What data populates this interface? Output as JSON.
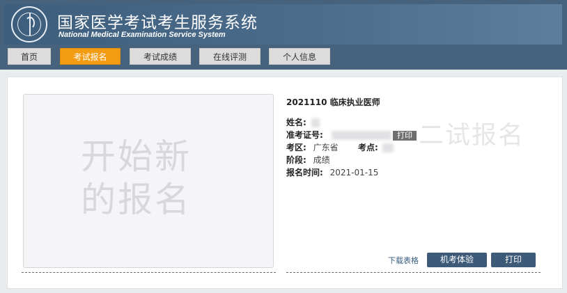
{
  "header": {
    "title_cn": "国家医学考试考生服务系统",
    "title_en": "National Medical Examination Service System",
    "emblem_icon": "medical-caduceus-icon"
  },
  "nav": {
    "items": [
      {
        "label": "首页",
        "active": false
      },
      {
        "label": "考试报名",
        "active": true
      },
      {
        "label": "考试成绩",
        "active": false
      },
      {
        "label": "在线评测",
        "active": false
      },
      {
        "label": "个人信息",
        "active": false
      }
    ]
  },
  "main": {
    "new_registration_text_line1": "开始新",
    "new_registration_text_line2": "的报名",
    "exam_title": "2021110 临床执业医师",
    "fields": {
      "name_label": "姓名:",
      "admission_label": "准考证号:",
      "admission_print_label": "打印",
      "region_label": "考区:",
      "region_value": "广东省",
      "site_label": "考点:",
      "stage_label": "阶段:",
      "stage_value": "成绩",
      "reg_time_label": "报名时间:",
      "reg_time_value": "2021-01-15"
    },
    "watermark_text": "二试报名",
    "download_link": "下载表格",
    "buttons": {
      "machine_exam": "机考体验",
      "print": "打印"
    }
  },
  "colors": {
    "header_bg": "#46627d",
    "nav_active": "#f39c12",
    "button_bg": "#3d5a78"
  }
}
